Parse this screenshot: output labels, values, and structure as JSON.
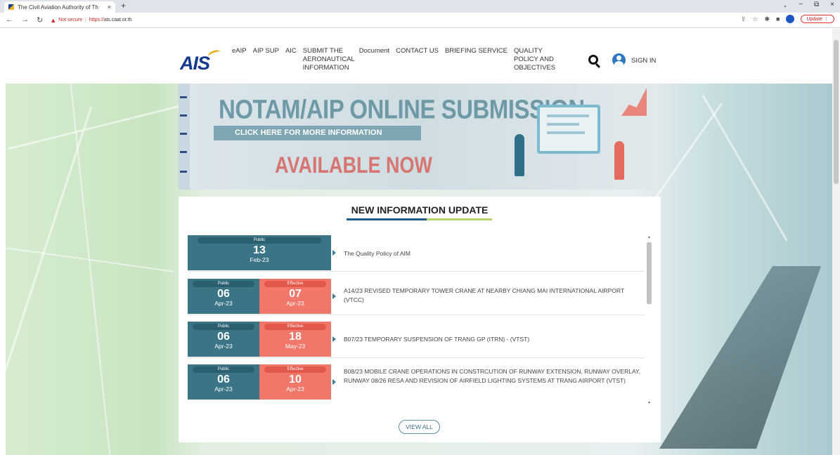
{
  "browser": {
    "tab_title": "The Civil Aviation Authority of Th",
    "tab_close": "×",
    "new_tab": "+",
    "security_label": "Not secure",
    "separator": "|",
    "url_protocol": "https://",
    "url_host": "ais.caat.or.th",
    "update_label": "Update",
    "window_controls": [
      "⌄",
      "−",
      "⧉",
      "×"
    ]
  },
  "header": {
    "logo": "AIS",
    "menu": [
      "eAIP",
      "AIP SUP",
      "AIC",
      "SUBMIT THE AERONAUTICAL INFORMATION",
      "Document",
      "CONTACT US",
      "BRIEFING SERVICE",
      "QUALITY POLICY AND OBJECTIVES"
    ],
    "signin": "SIGN IN"
  },
  "banner": {
    "title": "NOTAM/AIP ONLINE SUBMISSION",
    "cta": "CLICK HERE FOR MORE INFORMATION",
    "available": "AVAILABLE NOW"
  },
  "news": {
    "title": "NEW INFORMATION UPDATE",
    "items": [
      {
        "public_label": "Public",
        "public_day": "13",
        "public_mon": "Feb-23",
        "text": "The Quality Policy of AIM"
      },
      {
        "public_label": "Public",
        "public_day": "06",
        "public_mon": "Apr-23",
        "effective_label": "Effective",
        "effective_day": "07",
        "effective_mon": "Apr-23",
        "text": "A14/23 REVISED TEMPORARY TOWER CRANE AT NEARBY CHIANG MAI INTERNATIONAL AIRPORT (VTCC)"
      },
      {
        "public_label": "Public",
        "public_day": "06",
        "public_mon": "Apr-23",
        "effective_label": "Effective",
        "effective_day": "18",
        "effective_mon": "May-23",
        "text": "B07/23 TEMPORARY SUSPENSION OF TRANG GP (ITRN) - (VTST)"
      },
      {
        "public_label": "Public",
        "public_day": "06",
        "public_mon": "Apr-23",
        "effective_label": "Effective",
        "effective_day": "10",
        "effective_mon": "Apr-23",
        "text": "B08/23 MOBILE CRANE OPERATIONS IN CONSTRCUTION OF RUNWAY EXTENSION, RUNWAY OVERLAY, RUNWAY 08/26 RESA AND REVISION OF AIRFIELD LIGHTING SYSTEMS AT TRANG AIRPORT (VTST)"
      }
    ],
    "view_all": "VIEW ALL"
  }
}
